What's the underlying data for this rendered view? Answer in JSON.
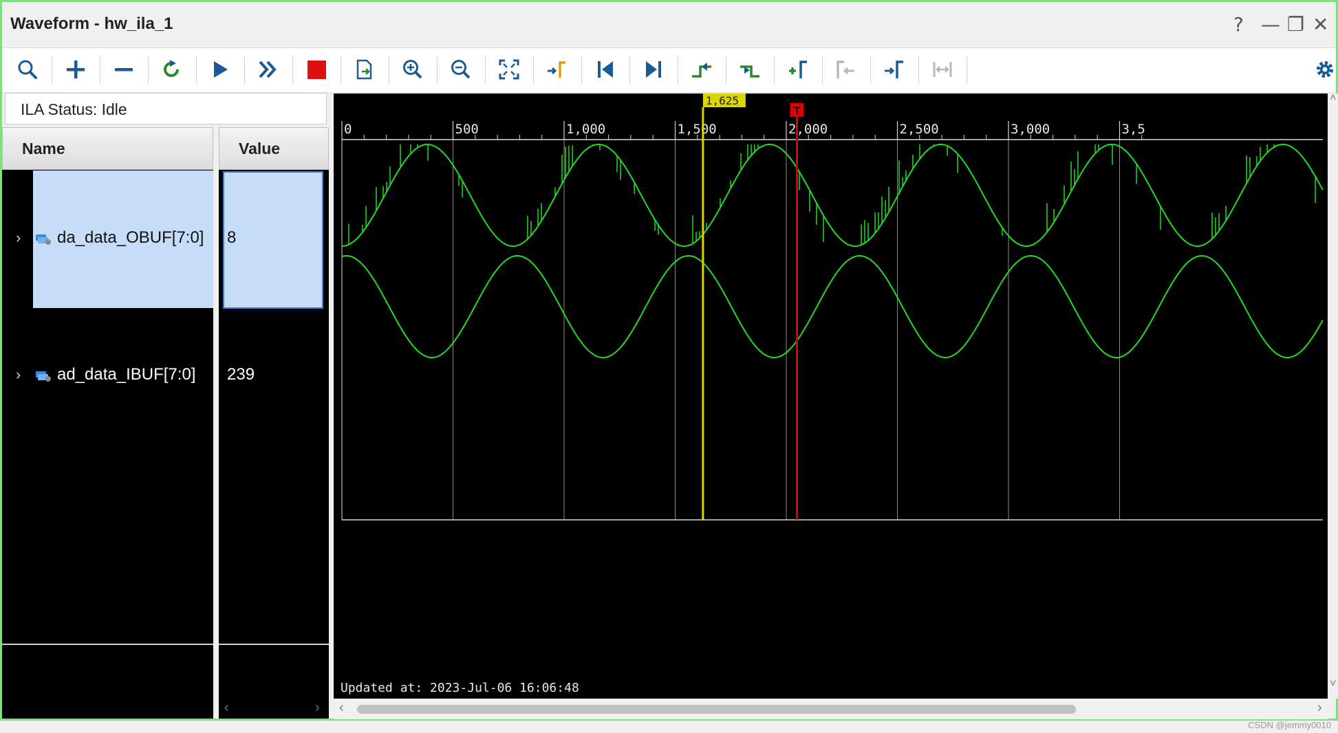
{
  "window": {
    "title": "Waveform - hw_ila_1",
    "controls": [
      "?",
      "—",
      "❐",
      "✕"
    ]
  },
  "toolbar": {
    "buttons": [
      {
        "name": "search-icon"
      },
      {
        "name": "add-icon"
      },
      {
        "name": "remove-icon"
      },
      {
        "name": "refresh-icon"
      },
      {
        "name": "run-trigger-icon"
      },
      {
        "name": "run-immediate-icon"
      },
      {
        "name": "stop-icon"
      },
      {
        "name": "export-icon"
      },
      {
        "name": "zoom-in-icon"
      },
      {
        "name": "zoom-out-icon"
      },
      {
        "name": "zoom-fit-icon"
      },
      {
        "name": "goto-cursor-icon"
      },
      {
        "name": "goto-start-icon"
      },
      {
        "name": "goto-end-icon"
      },
      {
        "name": "prev-transition-icon"
      },
      {
        "name": "next-transition-icon"
      },
      {
        "name": "add-marker-icon"
      },
      {
        "name": "prev-marker-icon"
      },
      {
        "name": "next-marker-icon"
      },
      {
        "name": "swap-cursors-icon"
      },
      {
        "name": "settings-icon"
      }
    ]
  },
  "ila_status": "ILA Status:  Idle",
  "columns": {
    "name": "Name",
    "value": "Value"
  },
  "signals": [
    {
      "name": "da_data_OBUF[7:0]",
      "value": "8"
    },
    {
      "name": "ad_data_IBUF[7:0]",
      "value": "239"
    }
  ],
  "cursor": {
    "label": "1,625",
    "time": 1625
  },
  "trigger": {
    "label": "T",
    "time": 2048
  },
  "timeline": {
    "start": 0,
    "end": 3600,
    "major_ticks": [
      {
        "t": 0,
        "label": "0"
      },
      {
        "t": 500,
        "label": "500"
      },
      {
        "t": 1000,
        "label": "1,000"
      },
      {
        "t": 1500,
        "label": "1,500"
      },
      {
        "t": 2000,
        "label": "2,000"
      },
      {
        "t": 2500,
        "label": "2,500"
      },
      {
        "t": 3000,
        "label": "3,000"
      },
      {
        "t": 3500,
        "label": "3,5"
      }
    ]
  },
  "waveforms": {
    "period": 770,
    "da_min_time": 0,
    "ad_max_time": 790
  },
  "updated": "Updated at: 2023-Jul-06 16:06:48",
  "watermark": "CSDN @jemmy0010",
  "colors": {
    "wave": "#22dd22",
    "cursor": "#d8d800",
    "trigger": "#e00000",
    "selection": "#c6dcf7"
  }
}
